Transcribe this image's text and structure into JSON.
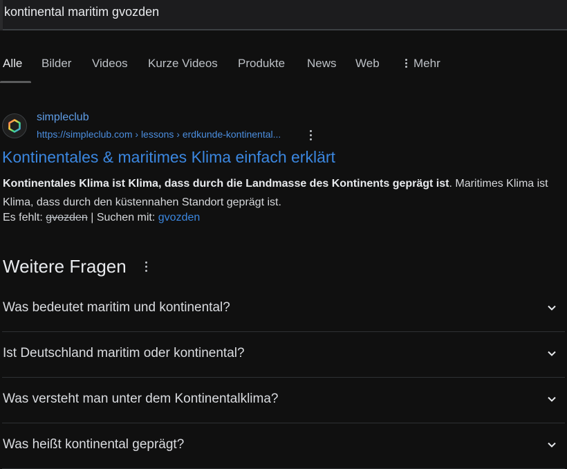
{
  "search": {
    "query": "kontinental maritim gvozden"
  },
  "tabs": [
    {
      "label": "Alle",
      "active": true
    },
    {
      "label": "Bilder"
    },
    {
      "label": "Videos"
    },
    {
      "label": "Kurze Videos"
    },
    {
      "label": "Produkte"
    },
    {
      "label": "News"
    },
    {
      "label": "Web"
    },
    {
      "label": "Mehr",
      "icon": "kebab-vertical-icon"
    }
  ],
  "result": {
    "favicon_icon": "simpleclub-hexagon-logo",
    "site_name": "simpleclub",
    "url": "https://simpleclub.com › lessons › erdkunde-kontinental...",
    "title": "Kontinentales & maritimes Klima einfach erklärt",
    "snippet_bold": "Kontinentales Klima ist Klima, dass durch die Landmasse des Kontinents geprägt ist",
    "snippet_rest": ". Maritimes Klima ist Klima, dass durch den küstennahen Standort geprägt ist.",
    "missing_prefix": "Es fehlt:",
    "missing_term": "gvozden",
    "search_with_prefix": "| Suchen mit:",
    "search_with_term": "gvozden"
  },
  "paa": {
    "header": "Weitere Fragen",
    "questions": [
      "Was bedeutet maritim und kontinental?",
      "Ist Deutschland maritim oder kontinental?",
      "Was versteht man unter dem Kontinentalklima?",
      "Was heißt kontinental geprägt?"
    ]
  },
  "colors": {
    "background": "#101010",
    "link": "#3b87e0",
    "text": "#e8eaed"
  }
}
